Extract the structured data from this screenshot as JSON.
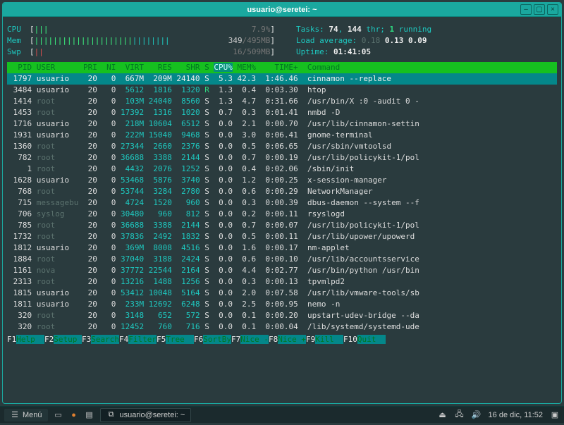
{
  "titlebar": {
    "title": "usuario@seretei: ~"
  },
  "meters": {
    "cpu": {
      "label": "CPU",
      "pct": "7.9%"
    },
    "mem": {
      "label": "Mem",
      "used": "349",
      "total": "495MB"
    },
    "swp": {
      "label": "Swp",
      "used": "16",
      "total": "509MB"
    }
  },
  "summary": {
    "tasks_label": "Tasks:",
    "tasks_procs": "74",
    "tasks_sep1": ", ",
    "tasks_threads": "144",
    "tasks_thr": " thr; ",
    "tasks_running": "1",
    "tasks_running_lbl": " running",
    "load_label": "Load average: ",
    "load1": "0.18",
    "load2": "0.13",
    "load3": "0.09",
    "uptime_label": "Uptime: ",
    "uptime": "01:41:05"
  },
  "columns": {
    "pid": "PID",
    "user": "USER",
    "pri": "PRI",
    "ni": "NI",
    "virt": "VIRT",
    "res": "RES",
    "shr": "SHR",
    "s": "S",
    "cpu": "CPU%",
    "mem": "MEM%",
    "time": "TIME+",
    "cmd": "Command"
  },
  "rows": [
    {
      "pid": "1797",
      "user": "usuario",
      "pri": "20",
      "ni": "0",
      "virt": "667M",
      "res": "209M",
      "shr": "24140",
      "s": "S",
      "cpu": "5.3",
      "mem": "42.3",
      "time": "1:46.46",
      "cmd": "cinnamon --replace",
      "hl": true
    },
    {
      "pid": "3484",
      "user": "usuario",
      "pri": "20",
      "ni": "0",
      "virt": "5612",
      "res": "1816",
      "shr": "1320",
      "s": "R",
      "cpu": "1.3",
      "mem": "0.4",
      "time": "0:03.30",
      "cmd": "htop"
    },
    {
      "pid": "1414",
      "user": "root",
      "pri": "20",
      "ni": "0",
      "virt": "103M",
      "res": "24040",
      "shr": "8560",
      "s": "S",
      "cpu": "1.3",
      "mem": "4.7",
      "time": "0:31.66",
      "cmd": "/usr/bin/X :0 -audit 0 -"
    },
    {
      "pid": "1453",
      "user": "root",
      "pri": "20",
      "ni": "0",
      "virt": "17392",
      "res": "1316",
      "shr": "1020",
      "s": "S",
      "cpu": "0.7",
      "mem": "0.3",
      "time": "0:01.41",
      "cmd": "nmbd -D"
    },
    {
      "pid": "1716",
      "user": "usuario",
      "pri": "20",
      "ni": "0",
      "virt": "218M",
      "res": "10604",
      "shr": "6512",
      "s": "S",
      "cpu": "0.0",
      "mem": "2.1",
      "time": "0:00.70",
      "cmd": "/usr/lib/cinnamon-settin"
    },
    {
      "pid": "1931",
      "user": "usuario",
      "pri": "20",
      "ni": "0",
      "virt": "222M",
      "res": "15040",
      "shr": "9468",
      "s": "S",
      "cpu": "0.0",
      "mem": "3.0",
      "time": "0:06.41",
      "cmd": "gnome-terminal"
    },
    {
      "pid": "1360",
      "user": "root",
      "pri": "20",
      "ni": "0",
      "virt": "27344",
      "res": "2660",
      "shr": "2376",
      "s": "S",
      "cpu": "0.0",
      "mem": "0.5",
      "time": "0:06.65",
      "cmd": "/usr/sbin/vmtoolsd"
    },
    {
      "pid": "782",
      "user": "root",
      "pri": "20",
      "ni": "0",
      "virt": "36688",
      "res": "3388",
      "shr": "2144",
      "s": "S",
      "cpu": "0.0",
      "mem": "0.7",
      "time": "0:00.19",
      "cmd": "/usr/lib/policykit-1/pol"
    },
    {
      "pid": "1",
      "user": "root",
      "pri": "20",
      "ni": "0",
      "virt": "4432",
      "res": "2076",
      "shr": "1252",
      "s": "S",
      "cpu": "0.0",
      "mem": "0.4",
      "time": "0:02.06",
      "cmd": "/sbin/init"
    },
    {
      "pid": "1628",
      "user": "usuario",
      "pri": "20",
      "ni": "0",
      "virt": "53468",
      "res": "5876",
      "shr": "3740",
      "s": "S",
      "cpu": "0.0",
      "mem": "1.2",
      "time": "0:00.25",
      "cmd": "x-session-manager"
    },
    {
      "pid": "768",
      "user": "root",
      "pri": "20",
      "ni": "0",
      "virt": "53744",
      "res": "3284",
      "shr": "2780",
      "s": "S",
      "cpu": "0.0",
      "mem": "0.6",
      "time": "0:00.29",
      "cmd": "NetworkManager"
    },
    {
      "pid": "715",
      "user": "messagebu",
      "pri": "20",
      "ni": "0",
      "virt": "4724",
      "res": "1520",
      "shr": "960",
      "s": "S",
      "cpu": "0.0",
      "mem": "0.3",
      "time": "0:00.39",
      "cmd": "dbus-daemon --system --f"
    },
    {
      "pid": "706",
      "user": "syslog",
      "pri": "20",
      "ni": "0",
      "virt": "30480",
      "res": "960",
      "shr": "812",
      "s": "S",
      "cpu": "0.0",
      "mem": "0.2",
      "time": "0:00.11",
      "cmd": "rsyslogd"
    },
    {
      "pid": "785",
      "user": "root",
      "pri": "20",
      "ni": "0",
      "virt": "36688",
      "res": "3388",
      "shr": "2144",
      "s": "S",
      "cpu": "0.0",
      "mem": "0.7",
      "time": "0:00.07",
      "cmd": "/usr/lib/policykit-1/pol"
    },
    {
      "pid": "1732",
      "user": "root",
      "pri": "20",
      "ni": "0",
      "virt": "37836",
      "res": "2492",
      "shr": "1832",
      "s": "S",
      "cpu": "0.0",
      "mem": "0.5",
      "time": "0:00.11",
      "cmd": "/usr/lib/upower/upowerd"
    },
    {
      "pid": "1812",
      "user": "usuario",
      "pri": "20",
      "ni": "0",
      "virt": "369M",
      "res": "8008",
      "shr": "4516",
      "s": "S",
      "cpu": "0.0",
      "mem": "1.6",
      "time": "0:00.17",
      "cmd": "nm-applet"
    },
    {
      "pid": "1884",
      "user": "root",
      "pri": "20",
      "ni": "0",
      "virt": "37040",
      "res": "3188",
      "shr": "2424",
      "s": "S",
      "cpu": "0.0",
      "mem": "0.6",
      "time": "0:00.10",
      "cmd": "/usr/lib/accountsservice"
    },
    {
      "pid": "1161",
      "user": "nova",
      "pri": "20",
      "ni": "0",
      "virt": "37772",
      "res": "22544",
      "shr": "2164",
      "s": "S",
      "cpu": "0.0",
      "mem": "4.4",
      "time": "0:02.77",
      "cmd": "/usr/bin/python /usr/bin"
    },
    {
      "pid": "2313",
      "user": "root",
      "pri": "20",
      "ni": "0",
      "virt": "13216",
      "res": "1488",
      "shr": "1256",
      "s": "S",
      "cpu": "0.0",
      "mem": "0.3",
      "time": "0:00.13",
      "cmd": "tpvmlpd2"
    },
    {
      "pid": "1815",
      "user": "usuario",
      "pri": "20",
      "ni": "0",
      "virt": "53412",
      "res": "10048",
      "shr": "5164",
      "s": "S",
      "cpu": "0.0",
      "mem": "2.0",
      "time": "0:07.58",
      "cmd": "/usr/lib/vmware-tools/sb"
    },
    {
      "pid": "1811",
      "user": "usuario",
      "pri": "20",
      "ni": "0",
      "virt": "233M",
      "res": "12692",
      "shr": "6248",
      "s": "S",
      "cpu": "0.0",
      "mem": "2.5",
      "time": "0:00.95",
      "cmd": "nemo -n"
    },
    {
      "pid": "320",
      "user": "root",
      "pri": "20",
      "ni": "0",
      "virt": "3148",
      "res": "652",
      "shr": "572",
      "s": "S",
      "cpu": "0.0",
      "mem": "0.1",
      "time": "0:00.20",
      "cmd": "upstart-udev-bridge --da"
    },
    {
      "pid": "320",
      "user": "root",
      "pri": "20",
      "ni": "0",
      "virt": "12452",
      "res": "760",
      "shr": "716",
      "s": "S",
      "cpu": "0.0",
      "mem": "0.1",
      "time": "0:00.04",
      "cmd": "/lib/systemd/systemd-ude"
    }
  ],
  "fnkeys": [
    {
      "k": "F1",
      "l": "Help  "
    },
    {
      "k": "F2",
      "l": "Setup "
    },
    {
      "k": "F3",
      "l": "Search"
    },
    {
      "k": "F4",
      "l": "Filter"
    },
    {
      "k": "F5",
      "l": "Tree  "
    },
    {
      "k": "F6",
      "l": "SortBy"
    },
    {
      "k": "F7",
      "l": "Nice -"
    },
    {
      "k": "F8",
      "l": "Nice +"
    },
    {
      "k": "F9",
      "l": "Kill  "
    },
    {
      "k": "F10",
      "l": "Quit  "
    }
  ],
  "taskbar": {
    "menu": "Menú",
    "task_title": "usuario@seretei: ~",
    "clock": "16 de dic, 11:52"
  }
}
